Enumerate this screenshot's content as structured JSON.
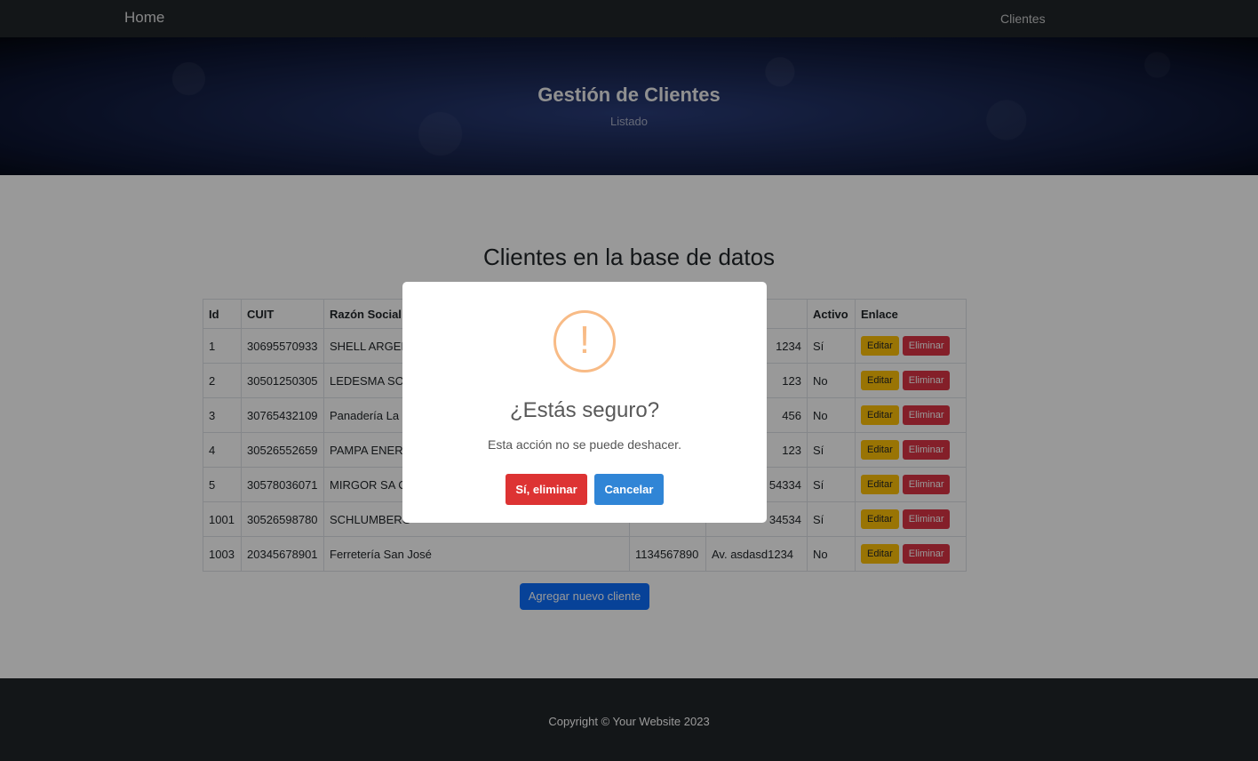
{
  "navbar": {
    "brand": "Home",
    "link": "Clientes"
  },
  "hero": {
    "title": "Gestión de Clientes",
    "subtitle": "Listado"
  },
  "main": {
    "title": "Clientes en la base de datos",
    "table": {
      "headers": [
        "Id",
        "CUIT",
        "Razón Social",
        "",
        "",
        "Activo",
        "Enlace"
      ],
      "rows": [
        [
          "1",
          "30695570933",
          "SHELL ARGENT",
          "",
          "1234",
          "Sí"
        ],
        [
          "2",
          "30501250305",
          "LEDESMA SOC",
          "",
          "123",
          "No"
        ],
        [
          "3",
          "30765432109",
          "Panadería La E",
          "",
          "456",
          "No"
        ],
        [
          "4",
          "30526552659",
          "PAMPA ENERG",
          "",
          "123",
          "Sí"
        ],
        [
          "5",
          "30578036071",
          "MIRGOR SA C",
          "",
          "54334",
          "Sí"
        ],
        [
          "1001",
          "30526598780",
          "SCHLUMBERG",
          "",
          "34534",
          "Sí"
        ],
        [
          "1003",
          "20345678901",
          "Ferretería San José",
          "1134567890",
          "Av. asdasd1234",
          "No"
        ]
      ],
      "edit_label": "Editar",
      "delete_label": "Eliminar"
    },
    "add_button": "Agregar nuevo cliente"
  },
  "footer": {
    "text": "Copyright © Your Website 2023"
  },
  "modal": {
    "icon": "!",
    "title": "¿Estás seguro?",
    "text": "Esta acción no se puede deshacer.",
    "confirm_label": "Sí, eliminar",
    "cancel_label": "Cancelar"
  },
  "colors": {
    "confirm": "#dd3333",
    "cancel": "#3085d6",
    "warning_icon": "#f8bb86",
    "edit": "#ffc107",
    "delete": "#dc3545",
    "primary": "#0d6efd"
  }
}
